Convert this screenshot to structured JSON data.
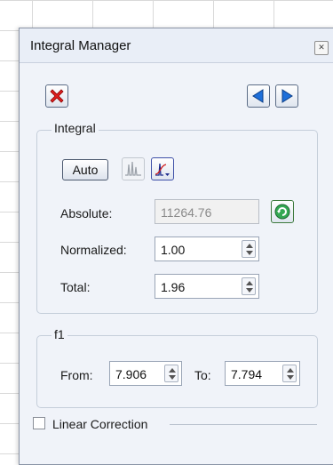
{
  "window": {
    "title": "Integral Manager"
  },
  "groups": {
    "integral_label": "Integral",
    "f1_label": "f1"
  },
  "integral": {
    "auto_label": "Auto",
    "absolute_label": "Absolute:",
    "absolute_value": "11264.76",
    "normalized_label": "Normalized:",
    "normalized_value": "1.00",
    "total_label": "Total:",
    "total_value": "1.96"
  },
  "f1": {
    "from_label": "From:",
    "from_value": "7.906",
    "to_label": "To:",
    "to_value": "7.794"
  },
  "linear_correction": {
    "label": "Linear Correction",
    "checked": false
  },
  "icons": {
    "delete": "red-x-icon",
    "prev": "blue-left-arrow-icon",
    "next": "blue-right-arrow-icon",
    "peaks": "peaks-icon",
    "integral_curve": "integral-curve-icon",
    "refresh": "green-refresh-icon"
  },
  "colors": {
    "delete_red": "#e02020",
    "nav_blue": "#1e6fd9",
    "refresh_green": "#34a853"
  }
}
